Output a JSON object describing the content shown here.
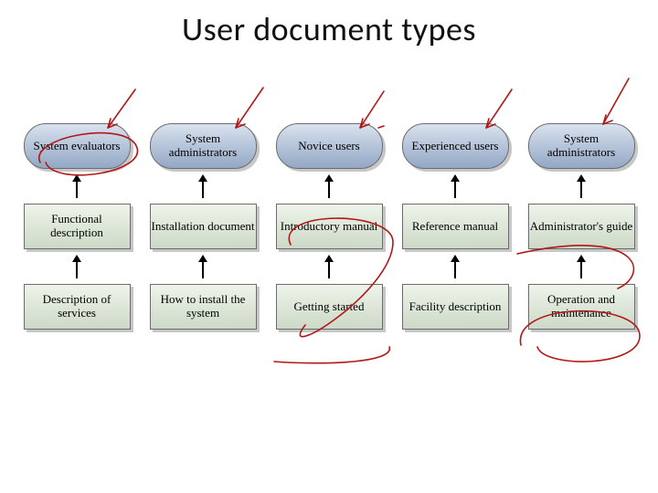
{
  "title": "User document types",
  "columns": [
    {
      "audience": "System evaluators",
      "document": "Functional description",
      "purpose": "Description of services"
    },
    {
      "audience": "System administrators",
      "document": "Installation document",
      "purpose": "How to install the system"
    },
    {
      "audience": "Novice users",
      "document": "Introductory manual",
      "purpose": "Getting started"
    },
    {
      "audience": "Experienced users",
      "document": "Reference manual",
      "purpose": "Facility description"
    },
    {
      "audience": "System administrators",
      "document": "Administrator's guide",
      "purpose": "Operation and maintenance"
    }
  ],
  "annotations": {
    "color": "#b01818",
    "marks_on_columns": [
      0,
      1,
      2,
      3,
      4
    ],
    "circles_on_columns": [
      0,
      2,
      4
    ]
  }
}
